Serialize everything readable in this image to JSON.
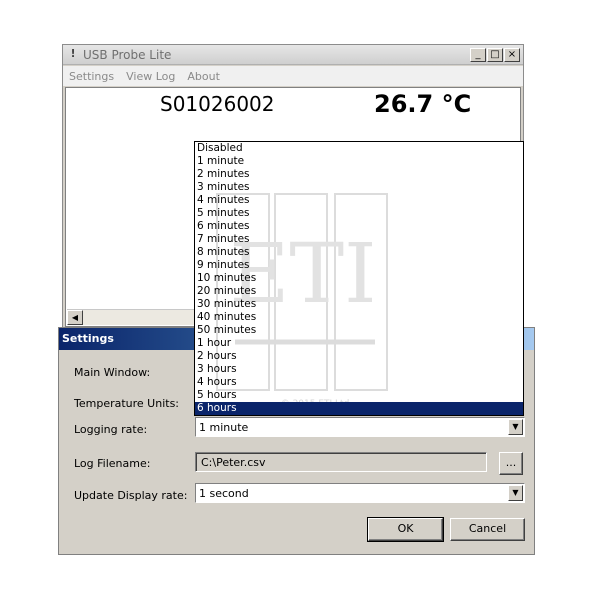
{
  "main_window": {
    "title": "USB Probe Lite",
    "menu": [
      "Settings",
      "View Log",
      "About"
    ],
    "serial": "S01026002",
    "temperature": "26.7 °C",
    "window_buttons": {
      "minimize": "_",
      "maximize": "□",
      "close": "×"
    }
  },
  "settings_dialog": {
    "title": "Settings",
    "fields": {
      "main_window_label": "Main Window:",
      "temperature_units_label": "Temperature Units:",
      "logging_rate_label": "Logging rate:",
      "logging_rate_value": "1 minute",
      "log_filename_label": "Log Filename:",
      "log_filename_value": "C:\\Peter.csv",
      "browse_label": "...",
      "update_display_rate_label": "Update Display rate:",
      "update_display_rate_value": "1 second"
    },
    "ok_label": "OK",
    "cancel_label": "Cancel"
  },
  "logging_rate_options": [
    "Disabled",
    "1 minute",
    "2 minutes",
    "3 minutes",
    "4 minutes",
    "5 minutes",
    "6 minutes",
    "7 minutes",
    "8 minutes",
    "9 minutes",
    "10 minutes",
    "20 minutes",
    "30 minutes",
    "40 minutes",
    "50 minutes",
    "1 hour",
    "2 hours",
    "3 hours",
    "4 hours",
    "5 hours",
    "6 hours"
  ],
  "selected_option": "6 hours",
  "watermark": {
    "letters": "ETI",
    "text": "© 2015 ETI Ltd"
  },
  "colors": {
    "selection": "#0a246a",
    "dialog_title_start": "#0a246a",
    "dialog_title_end": "#a6caf0",
    "chrome": "#d4d0c8"
  }
}
